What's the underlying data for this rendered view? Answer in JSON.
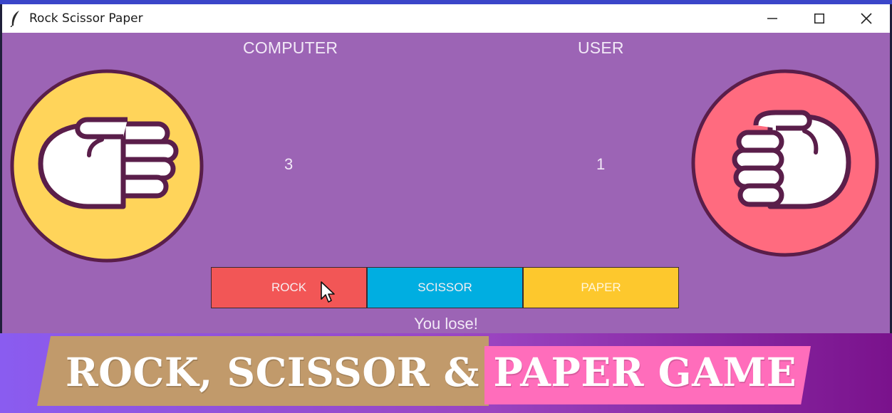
{
  "window": {
    "title": "Rock Scissor Paper",
    "controls": {
      "minimize": "—",
      "maximize": "☐",
      "close": "✕"
    }
  },
  "labels": {
    "computer": "COMPUTER",
    "user": "USER"
  },
  "scores": {
    "computer": "3",
    "user": "1"
  },
  "hands": {
    "computer": "paper",
    "user": "rock"
  },
  "buttons": {
    "rock": "ROCK",
    "scissor": "SCISSOR",
    "paper": "PAPER"
  },
  "result": "You lose!",
  "banner": {
    "title": "ROCK, SCISSOR & PAPER GAME"
  },
  "colors": {
    "background": "#9c64b5",
    "rock_button": "#f25656",
    "scissor_button": "#00aee1",
    "paper_button": "#fdc82d",
    "computer_circle": "#ffd45a",
    "user_circle": "#ff6b7f",
    "outline": "#5a1e4a"
  },
  "icons": [
    "feather-icon",
    "minimize-icon",
    "maximize-icon",
    "close-icon",
    "paper-hand-icon",
    "rock-hand-icon",
    "cursor-icon"
  ]
}
